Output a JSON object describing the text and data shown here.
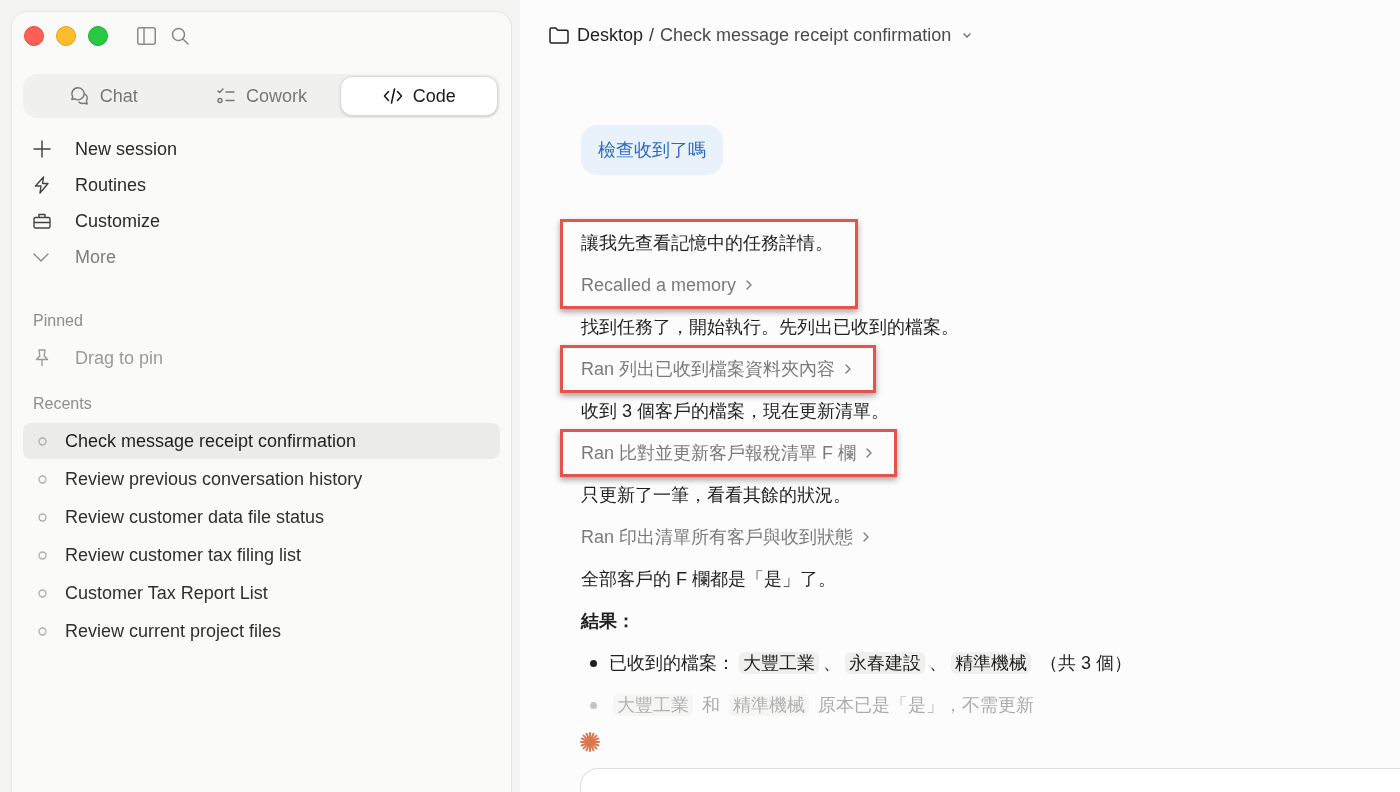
{
  "window_controls": [
    {
      "kind": "close"
    },
    {
      "kind": "minimize"
    },
    {
      "kind": "zoom"
    }
  ],
  "mode_tabs": [
    {
      "kind": "chat",
      "label": "Chat",
      "selected": false
    },
    {
      "kind": "cowork",
      "label": "Cowork",
      "selected": false
    },
    {
      "kind": "code",
      "label": "Code",
      "selected": true
    }
  ],
  "nav_items": [
    {
      "kind": "new",
      "label": "New session"
    },
    {
      "kind": "routines",
      "label": "Routines"
    },
    {
      "kind": "customize",
      "label": "Customize"
    },
    {
      "kind": "more",
      "label": "More"
    }
  ],
  "pinned": {
    "heading": "Pinned",
    "hint": "Drag to pin"
  },
  "recents": {
    "heading": "Recents",
    "items": [
      {
        "label": "Check message receipt confirmation",
        "selected": true
      },
      {
        "label": "Review previous conversation history",
        "selected": false
      },
      {
        "label": "Review customer data file status",
        "selected": false
      },
      {
        "label": "Review customer tax filing list",
        "selected": false
      },
      {
        "label": "Customer Tax Report List",
        "selected": false
      },
      {
        "label": "Review current project files",
        "selected": false
      }
    ]
  },
  "breadcrumb": {
    "folder": "Desktop",
    "separator": "/",
    "title": "Check message receipt confirmation"
  },
  "user_message": {
    "text": "檢查收到了嗎"
  },
  "transcript": [
    {
      "kind": "text",
      "text": "讓我先查看記憶中的任務詳情。",
      "highlighted": true
    },
    {
      "kind": "tool",
      "text": "Recalled a memory",
      "highlighted": true
    },
    {
      "kind": "text",
      "text": "找到任務了，開始執行。先列出已收到的檔案。",
      "highlighted": false
    },
    {
      "kind": "tool",
      "text": "Ran 列出已收到檔案資料夾內容",
      "highlighted": true
    },
    {
      "kind": "text",
      "text": "收到 3 個客戶的檔案，現在更新清單。",
      "highlighted": false
    },
    {
      "kind": "tool",
      "text": "Ran 比對並更新客戶報稅清單 F 欄",
      "highlighted": true
    },
    {
      "kind": "text",
      "text": "只更新了一筆，看看其餘的狀況。",
      "highlighted": false
    },
    {
      "kind": "tool",
      "text": "Ran 印出清單所有客戶與收到狀態",
      "highlighted": false
    },
    {
      "kind": "text",
      "text": "全部客戶的 F 欄都是「是」了。",
      "highlighted": false
    },
    {
      "kind": "heading",
      "text": "結果：",
      "highlighted": false
    },
    {
      "kind": "list",
      "highlighted": false,
      "items": [
        {
          "dimmed": false,
          "segments": [
            {
              "kind": "plain",
              "text": "已收到的檔案："
            },
            {
              "kind": "code",
              "text": "大豐工業"
            },
            {
              "kind": "plain",
              "text": "、"
            },
            {
              "kind": "code",
              "text": "永春建設"
            },
            {
              "kind": "plain",
              "text": "、"
            },
            {
              "kind": "code",
              "text": "精準機械"
            },
            {
              "kind": "plain",
              "text": " （共 3 個）"
            }
          ]
        },
        {
          "dimmed": true,
          "segments": [
            {
              "kind": "code",
              "text": "大豐工業"
            },
            {
              "kind": "plain",
              "text": " 和 "
            },
            {
              "kind": "code",
              "text": "精準機械"
            },
            {
              "kind": "plain",
              "text": " 原本已是「是」，不需更新"
            }
          ]
        }
      ]
    }
  ]
}
